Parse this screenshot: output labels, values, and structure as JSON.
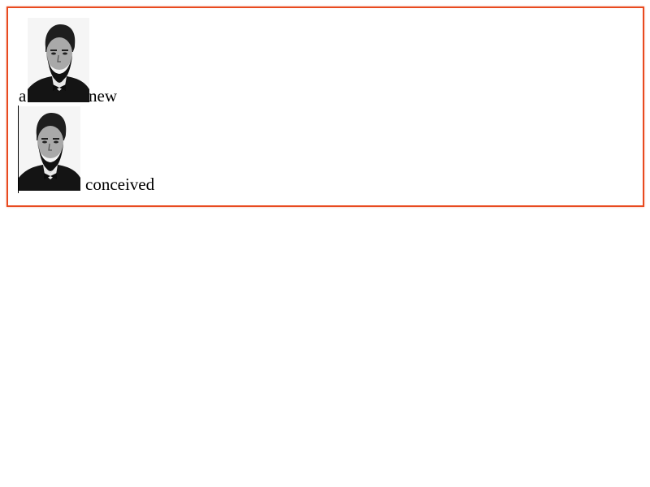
{
  "document": {
    "line1": {
      "before": "a",
      "after": "new"
    },
    "line2": {
      "after": "conceived"
    }
  },
  "images": [
    {
      "name": "portrait-image",
      "icon": "portrait-photo-icon"
    },
    {
      "name": "portrait-image",
      "icon": "portrait-photo-icon"
    }
  ],
  "colors": {
    "frame_border": "#e84a1f",
    "text": "#000000",
    "background": "#ffffff"
  }
}
